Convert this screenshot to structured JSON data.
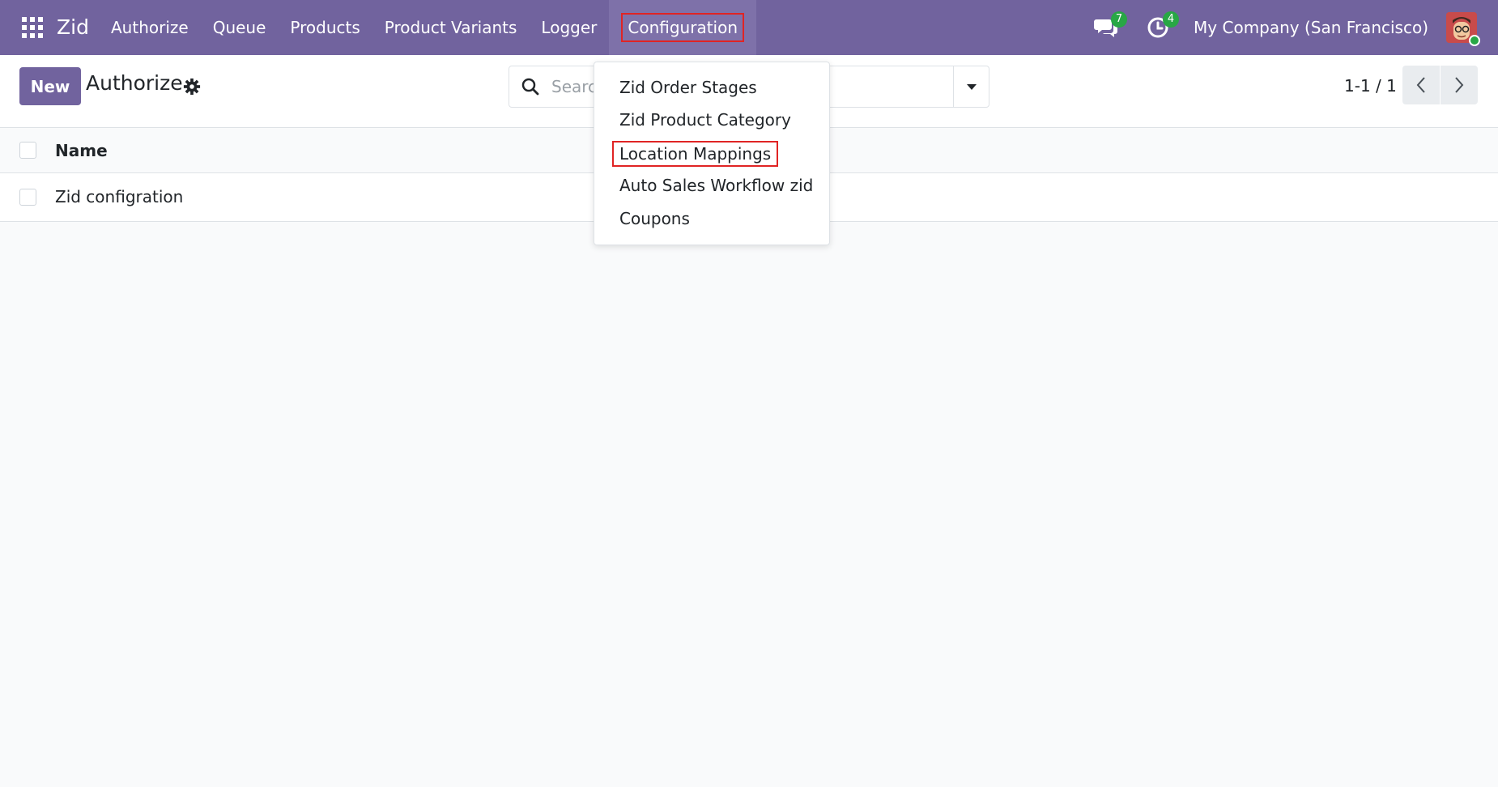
{
  "navbar": {
    "app_name": "Zid",
    "menu": [
      "Authorize",
      "Queue",
      "Products",
      "Product Variants",
      "Logger",
      "Configuration"
    ],
    "messages_count": "7",
    "activities_count": "4",
    "company": "My Company (San Francisco)",
    "icons": {
      "apps": "apps-grid-icon",
      "messages": "chat-bubbles-icon",
      "activities": "clock-icon",
      "avatar": "user-avatar"
    }
  },
  "control_panel": {
    "new_label": "New",
    "title": "Authorize",
    "search_placeholder": "Search...",
    "pager": "1-1 / 1"
  },
  "list": {
    "columns": [
      "Name"
    ],
    "rows": [
      [
        "Zid configration"
      ]
    ]
  },
  "dropdown": {
    "items": [
      "Zid Order Stages",
      "Zid Product Category",
      "Location Mappings",
      "Auto Sales Workflow zid",
      "Coupons"
    ],
    "highlighted": "Location Mappings"
  },
  "colors": {
    "navbar": "#71639e",
    "primary_button": "#71639e",
    "highlight_border": "#e02424",
    "badge": "#28a745"
  }
}
